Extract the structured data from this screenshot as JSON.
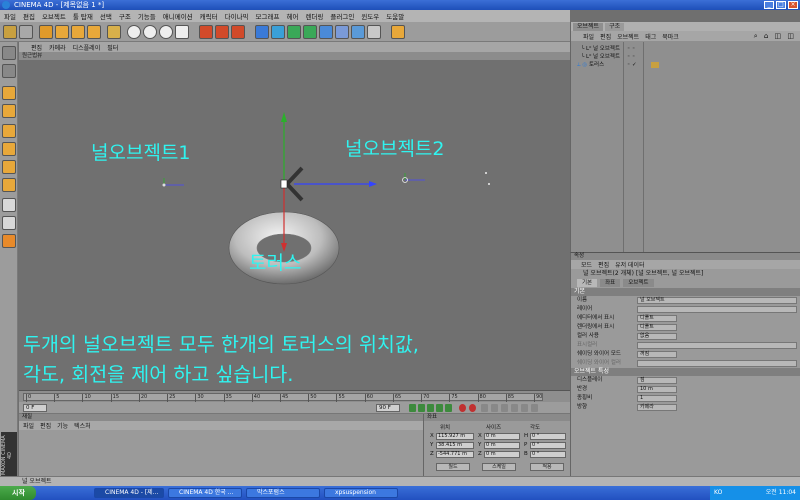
{
  "window": {
    "title": "CINEMA 4D - [제목없음 1 *]"
  },
  "menubar": [
    "파일",
    "편집",
    "오브젝트",
    "툴 탑재",
    "선택",
    "구조",
    "기능들",
    "애니메이션",
    "캐릭터",
    "다이나믹",
    "모그래프",
    "헤어",
    "렌더링",
    "플러그인",
    "윈도우",
    "도움말"
  ],
  "viewport": {
    "menu": [
      "편집",
      "카메라",
      "디스플레이",
      "필터"
    ],
    "label": "원근법뷰",
    "annotations": {
      "null1": "널오브젝트1",
      "null2": "널오브젝트2",
      "torus": "토러스",
      "message_line1": "두개의 널오브젝트 모두 한개의 토러스의 위치값,",
      "message_line2": "각도, 회전을 제어 하고 싶습니다."
    }
  },
  "timeline": {
    "ticks": [
      "0",
      "5",
      "10",
      "15",
      "20",
      "25",
      "30",
      "35",
      "40",
      "45",
      "50",
      "55",
      "60",
      "65",
      "70",
      "75",
      "80",
      "85",
      "90"
    ],
    "current_frame": "0 F",
    "end_frame": "90 F",
    "start_frame_field": "0 F"
  },
  "material_manager": {
    "title": "재질",
    "menu": [
      "파일",
      "편집",
      "기능",
      "텍스처"
    ]
  },
  "coordinates": {
    "title": "좌표",
    "headers": {
      "position": "위치",
      "size": "사이즈",
      "rotation": "각도"
    },
    "rows": [
      {
        "axis": "X",
        "pos": "115.927 m",
        "size": "0 m",
        "rot_label": "H",
        "rot": "0 °"
      },
      {
        "axis": "Y",
        "pos": "38.415 m",
        "size": "0 m",
        "rot_label": "P",
        "rot": "0 °"
      },
      {
        "axis": "Z",
        "pos": "-544.771 m",
        "size": "0 m",
        "rot_label": "B",
        "rot": "0 °"
      }
    ],
    "mode_object": "월드",
    "mode_size": "스케일",
    "apply_button": "적용"
  },
  "statusbar": {
    "text": "널 오브젝트"
  },
  "object_manager": {
    "tabs": [
      "오브젝트",
      "구조"
    ],
    "menu": [
      "파일",
      "편집",
      "오브젝트",
      "태그",
      "북마크"
    ],
    "objects": [
      {
        "name": "널 오브젝트"
      },
      {
        "name": "널 오브젝트"
      },
      {
        "name": "토러스"
      }
    ]
  },
  "attribute_manager": {
    "title": "속성",
    "menu": [
      "모드",
      "편집",
      "유저 데이터"
    ],
    "object_line": "널 오브젝트(2 개체) [널 오브젝트, 널 오브젝트]",
    "tabs": [
      "기본",
      "좌표",
      "오브젝트"
    ],
    "section_basic": "기본",
    "rows_basic": [
      {
        "label": "이름",
        "value": "널 오브젝트"
      },
      {
        "label": "레이어",
        "value": ""
      },
      {
        "label": "에디터에서 표시",
        "value": "디폴트"
      },
      {
        "label": "렌더링에서 표시",
        "value": "디폴트"
      },
      {
        "label": "컬러 사용",
        "value": "없음"
      },
      {
        "label": "표시컬러",
        "value": ""
      },
      {
        "label": "쉐이딩 와이어 모드",
        "value": "꺼짐"
      },
      {
        "label": "쉐이딩 와이어 컬러",
        "value": ""
      }
    ],
    "section_object": "오브젝트 특성",
    "rows_object": [
      {
        "label": "디스플레이",
        "value": "점"
      },
      {
        "label": "반경",
        "value": "10 m"
      },
      {
        "label": "종횡비",
        "value": "1"
      },
      {
        "label": "방향",
        "value": "카메라"
      }
    ]
  },
  "taskbar": {
    "start": "시작",
    "items": [
      "CINEMA 4D - [제...",
      "CINEMA 4D 한국 ...",
      "막스포럼스",
      "xpsuspension"
    ],
    "clock": "오전 11:04",
    "lang": "KO"
  }
}
